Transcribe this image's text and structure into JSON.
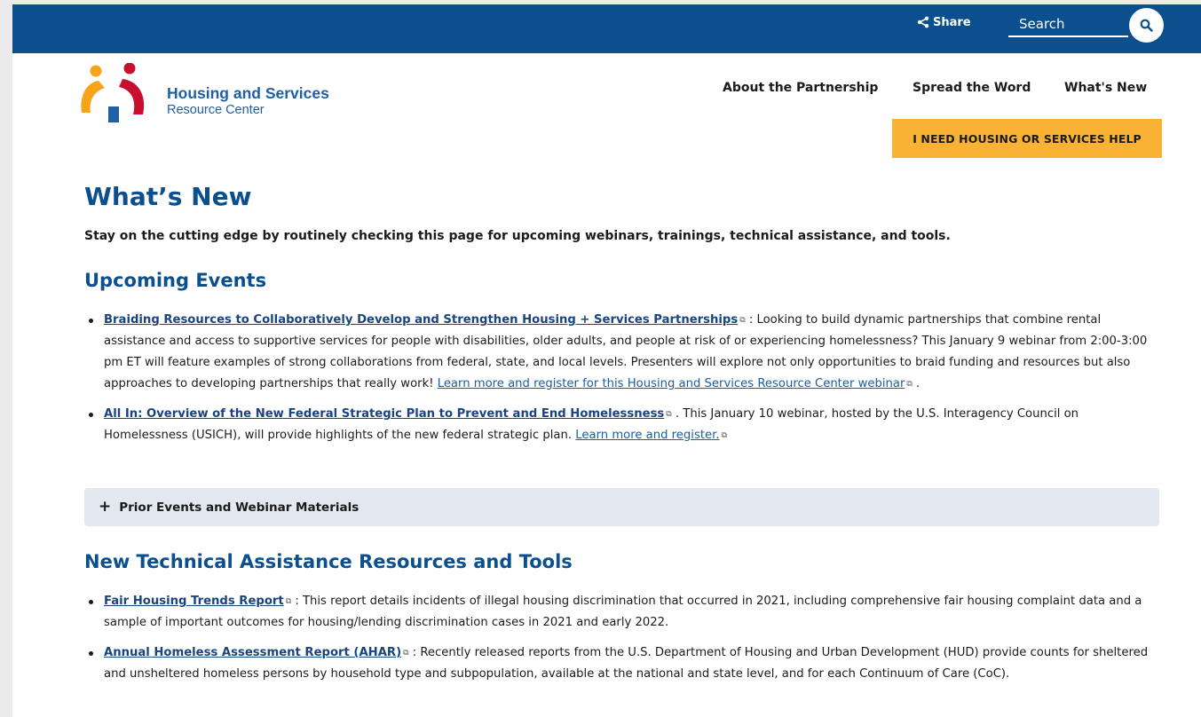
{
  "topbar": {
    "share_label": "Share",
    "search_placeholder": "Search"
  },
  "header": {
    "logo_line1": "Housing and Services",
    "logo_line2": "Resource Center",
    "nav": [
      "About the Partnership",
      "Spread the Word",
      "What's New"
    ],
    "help_button": "I NEED HOUSING OR SERVICES HELP"
  },
  "colors": {
    "brand_blue": "#0b4f8f",
    "accent_orange": "#f9b233",
    "logo_red": "#c8102e",
    "accordion_bg": "#e2e8f0"
  },
  "main": {
    "title": "What’s New",
    "intro": "Stay on the cutting edge by routinely checking this page for upcoming webinars, trainings, technical assistance, and tools.",
    "upcoming": {
      "heading": "Upcoming Events",
      "items": [
        {
          "title": "Braiding Resources to Collaboratively Develop and Strengthen Housing + Services Partnerships",
          "text": " : Looking to build dynamic partnerships that combine rental assistance and access to supportive services for people with disabilities, older adults, and people at risk of or experiencing homelessness? This January 9 webinar from 2:00-3:00 pm ET will feature examples of strong collaborations from federal, state, and local levels. Presenters will explore not only opportunities to braid funding and resources but also approaches to developing partnerships that really work! ",
          "link": "Learn more and register for this Housing and Services Resource Center webinar",
          "after": " ."
        },
        {
          "title": "All In: Overview of the New Federal Strategic Plan to Prevent and End Homelessness",
          "text": " . This January 10 webinar, hosted by the U.S. Interagency Council on Homelessness (USICH), will provide highlights of the new federal strategic plan. ",
          "link": "Learn more and register.",
          "after": ""
        }
      ]
    },
    "prior_events": "Prior Events and Webinar Materials",
    "resources": {
      "heading": "New Technical Assistance Resources and Tools",
      "items": [
        {
          "title": "Fair Housing Trends Report",
          "text": " : This report details incidents of illegal housing discrimination that occurred in 2021, including comprehensive fair housing complaint data and a sample of important outcomes for housing/lending discrimination cases in 2021 and early 2022."
        },
        {
          "title": "Annual Homeless Assessment Report (AHAR)",
          "text": " : Recently released reports from the U.S. Department of Housing and Urban Development (HUD) provide counts for sheltered and unsheltered homeless persons by household type and subpopulation, available at the national and state level, and for each Continuum of Care (CoC)."
        }
      ]
    }
  }
}
